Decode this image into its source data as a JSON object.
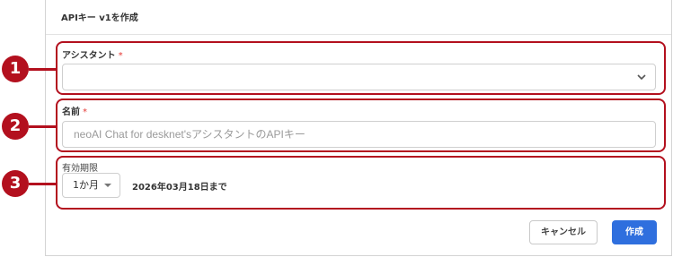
{
  "dialog": {
    "title": "APIキー v1を作成"
  },
  "fields": {
    "assistant": {
      "label": "アシスタント",
      "required_mark": "*",
      "value": ""
    },
    "name": {
      "label": "名前",
      "required_mark": "*",
      "placeholder": "neoAI Chat for desknet'sアシスタントのAPIキー"
    },
    "period": {
      "label": "有効期限",
      "selected": "1か月",
      "expiry_text": "2026年03月18日まで"
    }
  },
  "buttons": {
    "cancel": "キャンセル",
    "create": "作成"
  },
  "markers": [
    "1",
    "2",
    "3"
  ],
  "colors": {
    "highlight": "#b3101e",
    "primary": "#2f6fde",
    "required": "#e53935"
  }
}
